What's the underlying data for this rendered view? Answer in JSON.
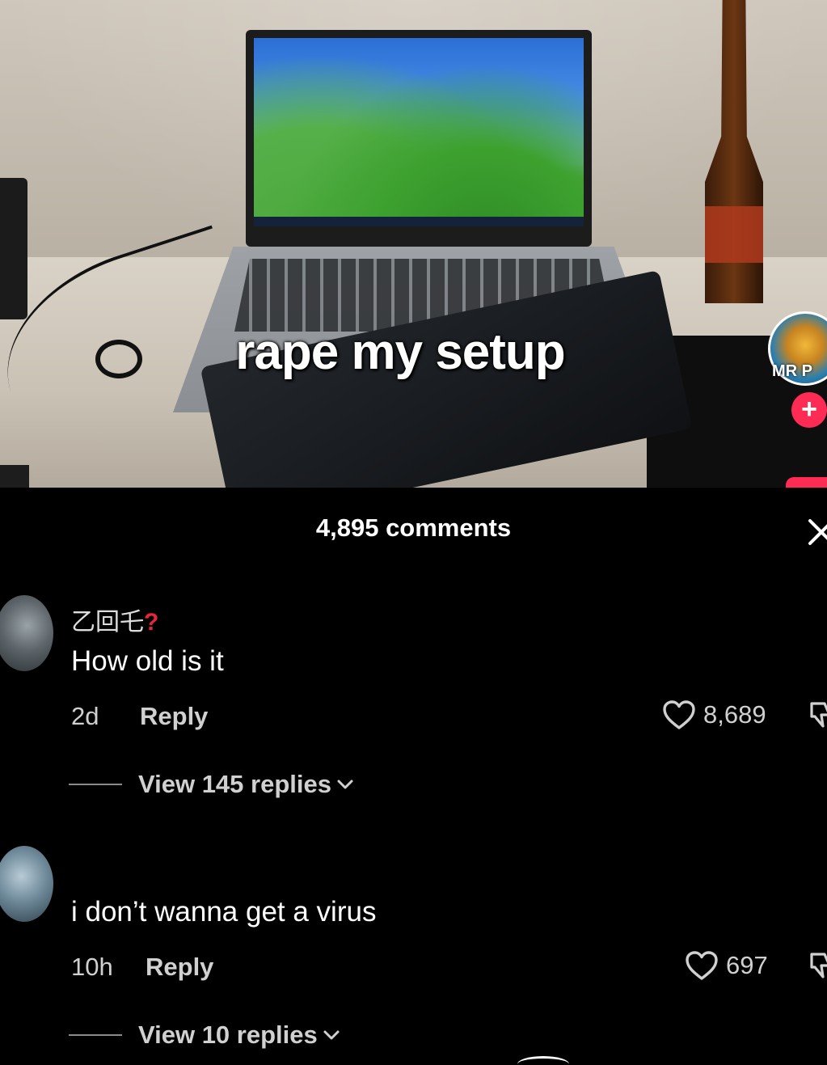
{
  "video": {
    "caption": "rape my setup",
    "creator_avatar_label": "MR P",
    "follow_button": "+"
  },
  "comments_panel": {
    "title": "4,895 comments",
    "comments": [
      {
        "username": "乙回乇",
        "username_mark": "?",
        "text": "How old is it",
        "age": "2d",
        "reply_label": "Reply",
        "likes": "8,689",
        "view_replies": "View 145 replies"
      },
      {
        "username": "",
        "text": "i don’t wanna get a virus",
        "age": "10h",
        "reply_label": "Reply",
        "likes": "697",
        "view_replies": "View 10 replies"
      }
    ]
  },
  "colors": {
    "panel_bg": "#000000",
    "accent": "#fe2c55",
    "muted_text": "#d0d0d0"
  },
  "icons": [
    "close-icon",
    "heart-icon",
    "dislike-icon",
    "chevron-down-icon",
    "plus-icon"
  ]
}
